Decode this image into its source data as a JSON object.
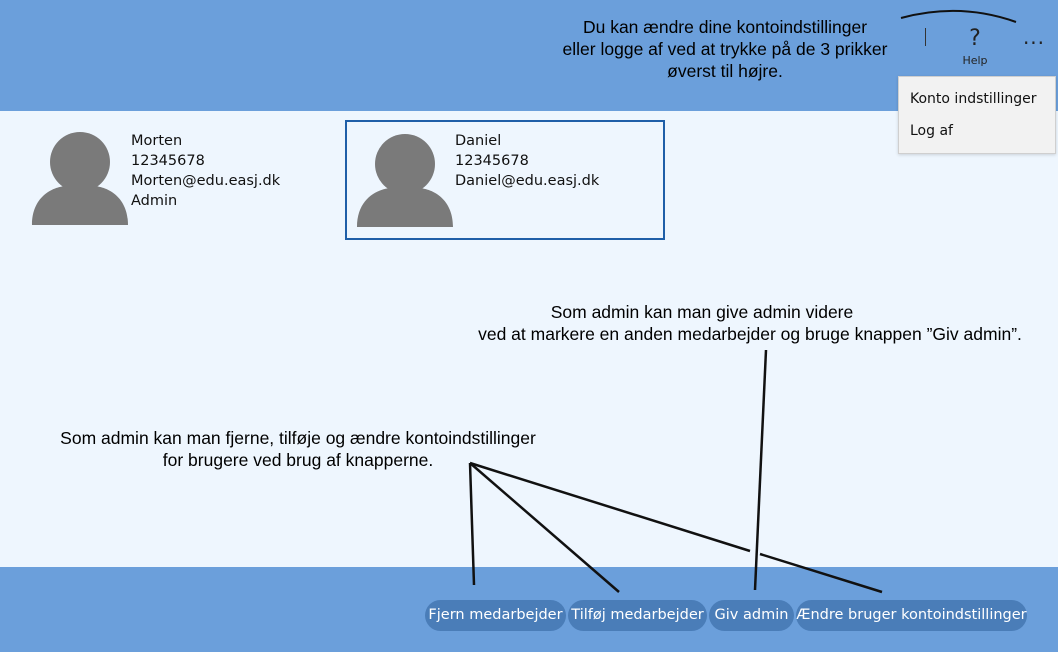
{
  "header": {
    "annotation_lines": [
      "Du kan ændre dine kontoindstillinger",
      "eller logge af ved at trykke på de 3 prikker",
      "øverst til højre."
    ],
    "help_glyph": "?",
    "help_label": "Help",
    "more_glyph": "...",
    "help_icon": "question-mark-icon",
    "more_icon": "ellipsis-icon"
  },
  "account_menu": {
    "items": [
      {
        "label": "Konto indstillinger"
      },
      {
        "label": "Log af"
      }
    ]
  },
  "users": [
    {
      "name": "Morten",
      "phone": "12345678",
      "email": "Morten@edu.easj.dk",
      "role": "Admin",
      "selected": false
    },
    {
      "name": "Daniel",
      "phone": "12345678",
      "email": "Daniel@edu.easj.dk",
      "role": "",
      "selected": true
    }
  ],
  "annotations": {
    "give_admin": [
      "Som admin kan man give admin videre",
      "ved at markere en anden medarbejder og bruge knappen ”Giv admin”."
    ],
    "buttons_info": [
      "Som admin kan man fjerne, tilføje og ændre kontoindstillinger",
      "for brugere ved brug af knapperne."
    ]
  },
  "actions": {
    "remove_label": "Fjern medarbejder",
    "add_label": "Tilføj medarbejder",
    "give_admin_label": "Giv admin",
    "edit_label": "Ændre bruger kontoindstillinger"
  },
  "colors": {
    "bar": "#6b9fdb",
    "background": "#eef6fe",
    "button": "#4a7db8",
    "selection_border": "#1f5fa8",
    "avatar": "#7a7a7a"
  }
}
